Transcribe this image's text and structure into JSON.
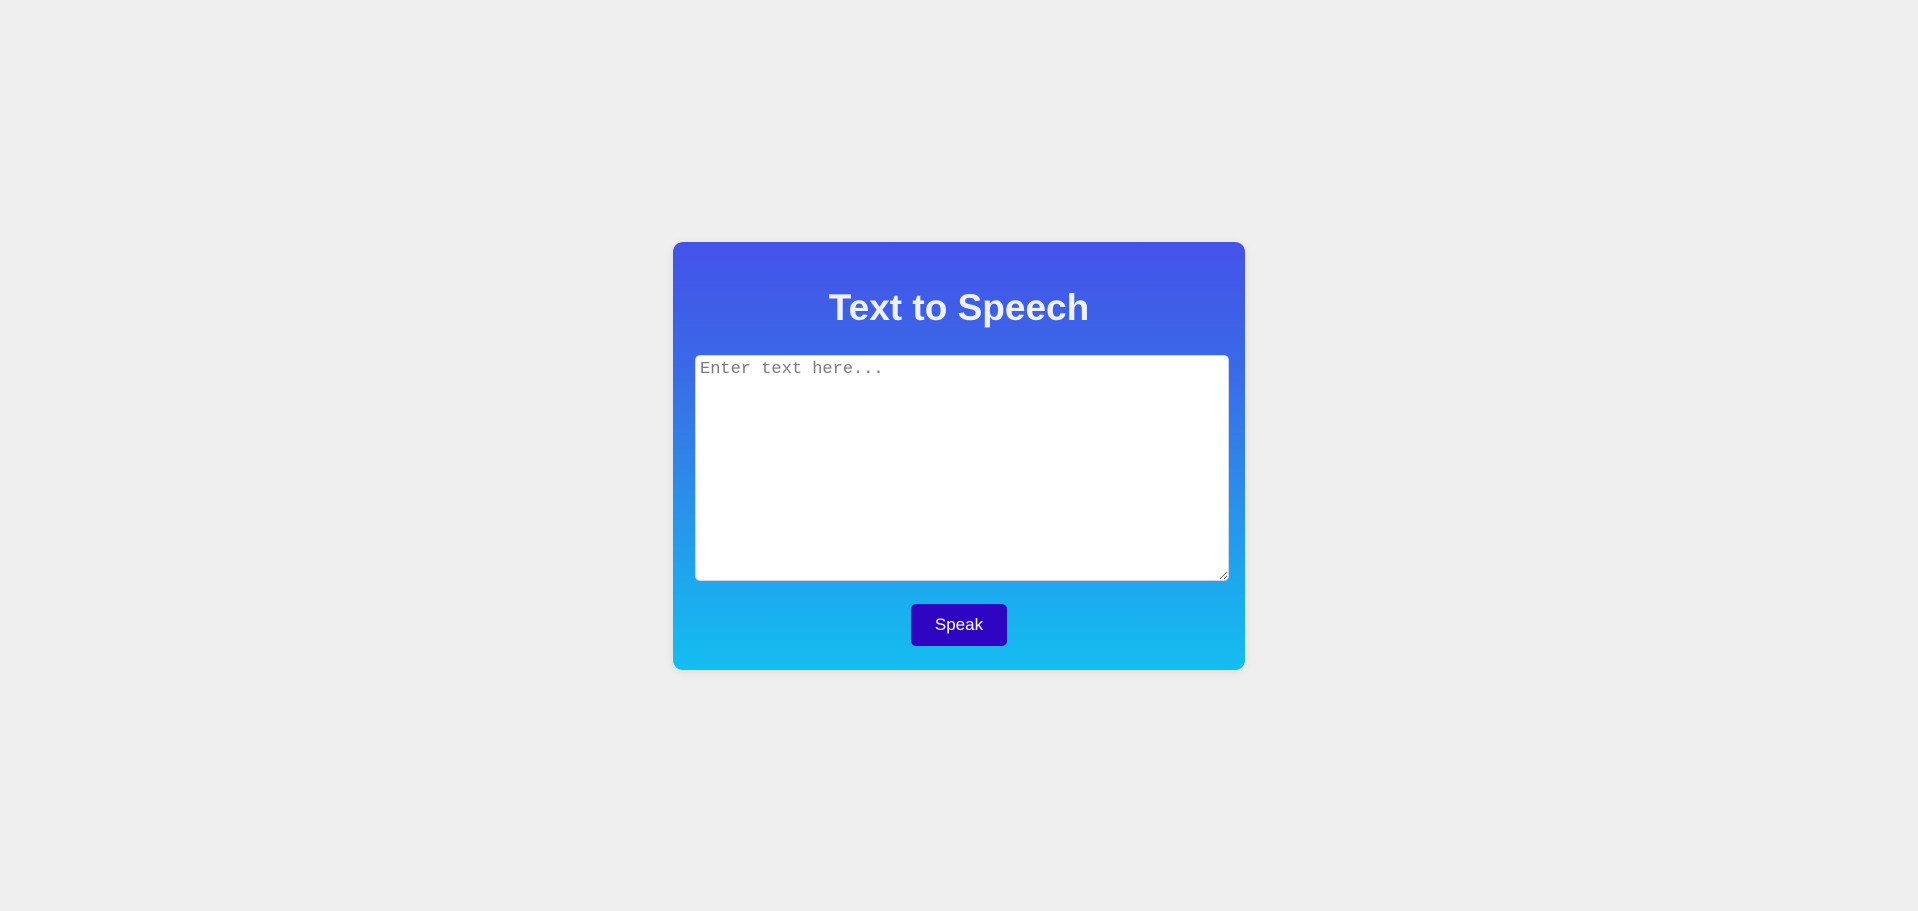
{
  "app": {
    "title": "Text to Speech"
  },
  "input": {
    "placeholder": "Enter text here...",
    "value": ""
  },
  "actions": {
    "speak_label": "Speak"
  },
  "colors": {
    "page_background": "#efefef",
    "card_gradient_top": "#4452e9",
    "card_gradient_bottom": "#14bdf0",
    "button_background": "#2f05c4",
    "title_text": "#eef1ff"
  }
}
